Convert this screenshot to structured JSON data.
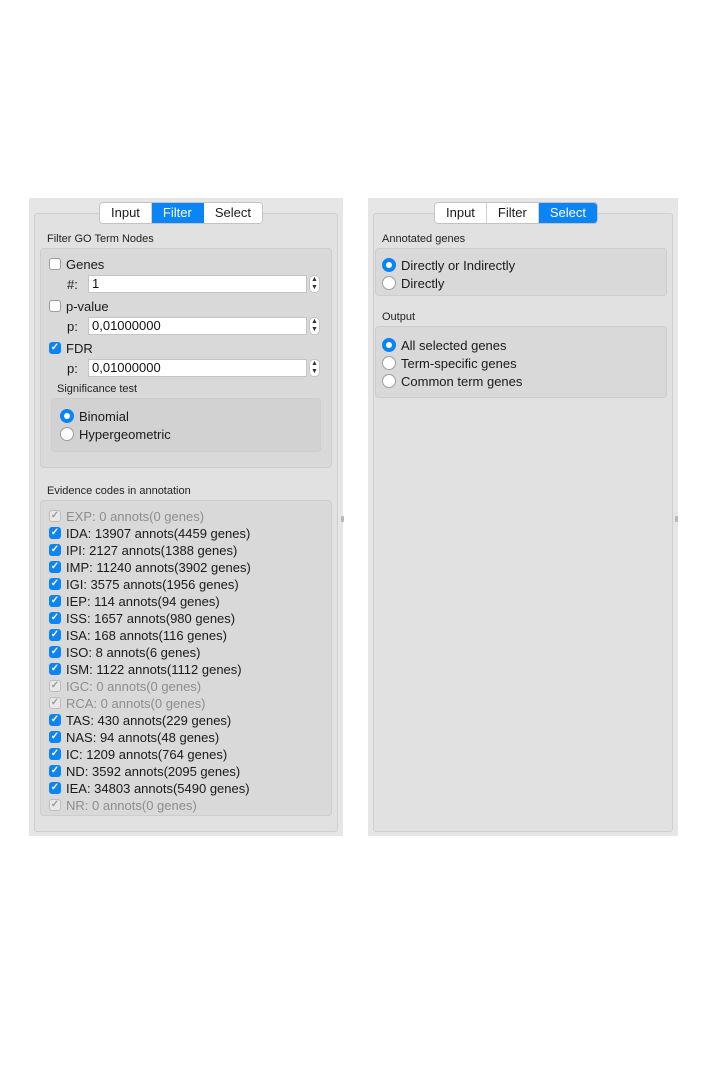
{
  "left_panel": {
    "tabs": [
      {
        "label": "Input",
        "active": false
      },
      {
        "label": "Filter",
        "active": true
      },
      {
        "label": "Select",
        "active": false
      }
    ],
    "filter_section_title": "Filter GO Term Nodes",
    "genes": {
      "label": "Genes",
      "checked": false,
      "field_label": "#:",
      "value": "1"
    },
    "pvalue": {
      "label": "p-value",
      "checked": false,
      "field_label": "p:",
      "value": "0,01000000"
    },
    "fdr": {
      "label": "FDR",
      "checked": true,
      "field_label": "p:",
      "value": "0,01000000"
    },
    "significance_title": "Significance test",
    "significance_options": [
      {
        "label": "Binomial",
        "selected": true
      },
      {
        "label": "Hypergeometric",
        "selected": false
      }
    ],
    "evidence_title": "Evidence codes in annotation",
    "evidence_codes": [
      {
        "label": "EXP: 0 annots(0 genes)",
        "checked": true,
        "enabled": false
      },
      {
        "label": "IDA: 13907 annots(4459 genes)",
        "checked": true,
        "enabled": true
      },
      {
        "label": "IPI: 2127 annots(1388 genes)",
        "checked": true,
        "enabled": true
      },
      {
        "label": "IMP: 11240 annots(3902 genes)",
        "checked": true,
        "enabled": true
      },
      {
        "label": "IGI: 3575 annots(1956 genes)",
        "checked": true,
        "enabled": true
      },
      {
        "label": "IEP: 114 annots(94 genes)",
        "checked": true,
        "enabled": true
      },
      {
        "label": "ISS: 1657 annots(980 genes)",
        "checked": true,
        "enabled": true
      },
      {
        "label": "ISA: 168 annots(116 genes)",
        "checked": true,
        "enabled": true
      },
      {
        "label": "ISO: 8 annots(6 genes)",
        "checked": true,
        "enabled": true
      },
      {
        "label": "ISM: 1122 annots(1112 genes)",
        "checked": true,
        "enabled": true
      },
      {
        "label": "IGC: 0 annots(0 genes)",
        "checked": true,
        "enabled": false
      },
      {
        "label": "RCA: 0 annots(0 genes)",
        "checked": true,
        "enabled": false
      },
      {
        "label": "TAS: 430 annots(229 genes)",
        "checked": true,
        "enabled": true
      },
      {
        "label": "NAS: 94 annots(48 genes)",
        "checked": true,
        "enabled": true
      },
      {
        "label": "IC: 1209 annots(764 genes)",
        "checked": true,
        "enabled": true
      },
      {
        "label": "ND: 3592 annots(2095 genes)",
        "checked": true,
        "enabled": true
      },
      {
        "label": "IEA: 34803 annots(5490 genes)",
        "checked": true,
        "enabled": true
      },
      {
        "label": "NR: 0 annots(0 genes)",
        "checked": true,
        "enabled": false
      }
    ]
  },
  "right_panel": {
    "tabs": [
      {
        "label": "Input",
        "active": false
      },
      {
        "label": "Filter",
        "active": false
      },
      {
        "label": "Select",
        "active": true
      }
    ],
    "annotated_title": "Annotated genes",
    "annotated_options": [
      {
        "label": "Directly or Indirectly",
        "selected": true
      },
      {
        "label": "Directly",
        "selected": false
      }
    ],
    "output_title": "Output",
    "output_options": [
      {
        "label": "All selected genes",
        "selected": true
      },
      {
        "label": "Term-specific genes",
        "selected": false
      },
      {
        "label": "Common term genes",
        "selected": false
      }
    ]
  },
  "colors": {
    "accent": "#0b84f5",
    "panel": "#e6e6e6",
    "group": "#d9d9d9"
  }
}
